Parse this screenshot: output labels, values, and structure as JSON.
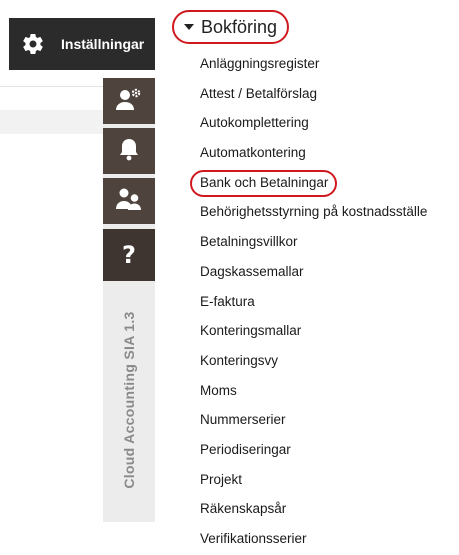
{
  "settings_button": {
    "label": "Inställningar",
    "icon": "gear-icon"
  },
  "sidebar_icons": [
    {
      "name": "user-settings-icon"
    },
    {
      "name": "bell-icon"
    },
    {
      "name": "users-icon"
    },
    {
      "name": "help-icon",
      "glyph": "?"
    }
  ],
  "version": "Cloud Accounting SIA 1.3",
  "menu": {
    "section_title": "Bokföring",
    "items": [
      "Anläggningsregister",
      "Attest / Betalförslag",
      "Autokomplettering",
      "Automatkontering",
      "Bank och Betalningar",
      "Behörighetsstyrning på kostnadsställe",
      "Betalningsvillkor",
      "Dagskassemallar",
      "E-faktura",
      "Konteringsmallar",
      "Konteringsvy",
      "Moms",
      "Nummerserier",
      "Periodiseringar",
      "Projekt",
      "Räkenskapsår",
      "Verifikationsserier"
    ]
  },
  "colors": {
    "annotation": "#d0191f",
    "dark_button": "#2b2b2b",
    "sidebar_button": "#4f433d"
  }
}
